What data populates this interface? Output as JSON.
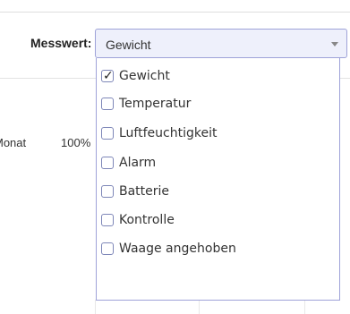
{
  "filter": {
    "label": "Messwert:",
    "selected_value": "Gewicht"
  },
  "background_row": {
    "col1": "Monat",
    "col2": "100%"
  },
  "dropdown": {
    "options": [
      {
        "label": "Gewicht",
        "checked": true
      },
      {
        "label": "Temperatur",
        "checked": false
      },
      {
        "label": "Luftfeuchtigkeit",
        "checked": false
      },
      {
        "label": "Alarm",
        "checked": false
      },
      {
        "label": "Batterie",
        "checked": false
      },
      {
        "label": "Kontrolle",
        "checked": false
      },
      {
        "label": "Waage angehoben",
        "checked": false
      }
    ]
  },
  "icons": {
    "dropdown_arrow": "chevron-down-icon",
    "checked_mark": "checkmark-icon"
  },
  "colors": {
    "select_border": "#9ea2d8",
    "select_background": "#eef0fb",
    "checkbox_border": "#7e87b8"
  }
}
